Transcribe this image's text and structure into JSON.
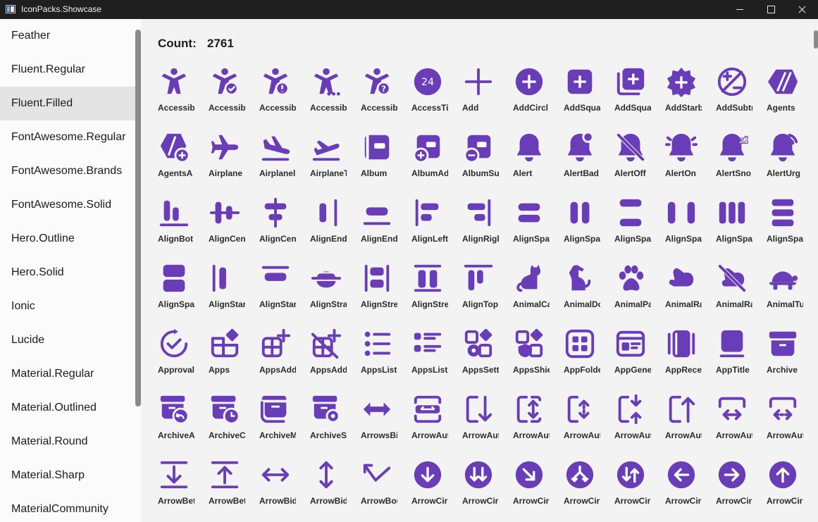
{
  "window": {
    "title": "IconPacks.Showcase"
  },
  "sidebar": {
    "items": [
      {
        "label": "Feather",
        "selected": false
      },
      {
        "label": "Fluent.Regular",
        "selected": false
      },
      {
        "label": "Fluent.Filled",
        "selected": true
      },
      {
        "label": "FontAwesome.Regular",
        "selected": false
      },
      {
        "label": "FontAwesome.Brands",
        "selected": false
      },
      {
        "label": "FontAwesome.Solid",
        "selected": false
      },
      {
        "label": "Hero.Outline",
        "selected": false
      },
      {
        "label": "Hero.Solid",
        "selected": false
      },
      {
        "label": "Ionic",
        "selected": false
      },
      {
        "label": "Lucide",
        "selected": false
      },
      {
        "label": "Material.Regular",
        "selected": false
      },
      {
        "label": "Material.Outlined",
        "selected": false
      },
      {
        "label": "Material.Round",
        "selected": false
      },
      {
        "label": "Material.Sharp",
        "selected": false
      },
      {
        "label": "MaterialCommunity",
        "selected": false
      }
    ]
  },
  "main": {
    "count_label": "Count:",
    "count_value": "2761",
    "icon_color": "#6a3db8",
    "icons": [
      {
        "label": "Accessib",
        "icon": "accessibility-icon"
      },
      {
        "label": "Accessib",
        "icon": "accessibility-check-icon"
      },
      {
        "label": "Accessib",
        "icon": "accessibility-error-icon"
      },
      {
        "label": "Accessib",
        "icon": "accessibility-more-icon"
      },
      {
        "label": "Accessib",
        "icon": "accessibility-question-icon"
      },
      {
        "label": "AccessTi",
        "icon": "access-time-24-icon",
        "glyph": "24"
      },
      {
        "label": "Add",
        "icon": "add-icon"
      },
      {
        "label": "AddCircl",
        "icon": "add-circle-icon"
      },
      {
        "label": "AddSqua",
        "icon": "add-square-icon"
      },
      {
        "label": "AddSqua",
        "icon": "add-square-multiple-icon"
      },
      {
        "label": "AddStarb",
        "icon": "add-starburst-icon"
      },
      {
        "label": "AddSubtr",
        "icon": "add-subtract-circle-icon"
      },
      {
        "label": "Agents",
        "icon": "agents-icon"
      },
      {
        "label": "AgentsA",
        "icon": "agents-add-icon"
      },
      {
        "label": "Airplane",
        "icon": "airplane-icon"
      },
      {
        "label": "Airplanel",
        "icon": "airplane-landing-icon"
      },
      {
        "label": "AirplaneT",
        "icon": "airplane-takeoff-icon"
      },
      {
        "label": "Album",
        "icon": "album-icon"
      },
      {
        "label": "AlbumAd",
        "icon": "album-add-icon"
      },
      {
        "label": "AlbumSu",
        "icon": "album-subtract-icon"
      },
      {
        "label": "Alert",
        "icon": "alert-icon"
      },
      {
        "label": "AlertBad",
        "icon": "alert-badge-icon"
      },
      {
        "label": "AlertOff",
        "icon": "alert-off-icon"
      },
      {
        "label": "AlertOn",
        "icon": "alert-on-icon"
      },
      {
        "label": "AlertSno",
        "icon": "alert-snooze-icon",
        "glyph": "zZ"
      },
      {
        "label": "AlertUrg",
        "icon": "alert-urgent-icon"
      },
      {
        "label": "AlignBot",
        "icon": "align-bottom-icon"
      },
      {
        "label": "AlignCen",
        "icon": "align-center-horizontal-icon"
      },
      {
        "label": "AlignCen",
        "icon": "align-center-vertical-icon"
      },
      {
        "label": "AlignEnd",
        "icon": "align-end-horizontal-icon"
      },
      {
        "label": "AlignEnd",
        "icon": "align-end-vertical-icon"
      },
      {
        "label": "AlignLeft",
        "icon": "align-left-icon"
      },
      {
        "label": "AlignRigl",
        "icon": "align-right-icon"
      },
      {
        "label": "AlignSpa",
        "icon": "align-space-around-horizontal-icon"
      },
      {
        "label": "AlignSpa",
        "icon": "align-space-around-vertical-icon"
      },
      {
        "label": "AlignSpa",
        "icon": "align-space-between-horizontal-icon"
      },
      {
        "label": "AlignSpa",
        "icon": "align-space-between-vertical-icon"
      },
      {
        "label": "AlignSpa",
        "icon": "align-space-evenly-horizontal-icon"
      },
      {
        "label": "AlignSpa",
        "icon": "align-space-evenly-vertical-icon"
      },
      {
        "label": "AlignSpa",
        "icon": "align-space-fit-vertical-icon"
      },
      {
        "label": "AlignStar",
        "icon": "align-start-horizontal-icon"
      },
      {
        "label": "AlignStar",
        "icon": "align-start-vertical-icon"
      },
      {
        "label": "AlignStra",
        "icon": "align-stretch-horizontal-icon"
      },
      {
        "label": "AlignStre",
        "icon": "align-stretch-vertical-icon"
      },
      {
        "label": "AlignStre",
        "icon": "align-stretch-top-icon"
      },
      {
        "label": "AlignTop",
        "icon": "align-top-icon"
      },
      {
        "label": "AnimalCa",
        "icon": "animal-cat-icon"
      },
      {
        "label": "AnimalDo",
        "icon": "animal-dog-icon"
      },
      {
        "label": "AnimalPa",
        "icon": "animal-paw-print-icon"
      },
      {
        "label": "AnimalRa",
        "icon": "animal-rabbit-icon"
      },
      {
        "label": "AnimalRa",
        "icon": "animal-rabbit-off-icon"
      },
      {
        "label": "AnimalTu",
        "icon": "animal-turtle-icon"
      },
      {
        "label": "Approval",
        "icon": "approvals-app-icon"
      },
      {
        "label": "Apps",
        "icon": "apps-icon"
      },
      {
        "label": "AppsAdd",
        "icon": "apps-add-in-icon"
      },
      {
        "label": "AppsAdd",
        "icon": "apps-add-in-off-icon"
      },
      {
        "label": "AppsList",
        "icon": "apps-list-icon"
      },
      {
        "label": "AppsList",
        "icon": "apps-list-detail-icon"
      },
      {
        "label": "AppsSett",
        "icon": "apps-settings-icon"
      },
      {
        "label": "AppsShie",
        "icon": "apps-shield-icon"
      },
      {
        "label": "AppFolde",
        "icon": "app-folder-icon"
      },
      {
        "label": "AppGene",
        "icon": "app-generic-icon"
      },
      {
        "label": "AppRece",
        "icon": "app-recent-icon"
      },
      {
        "label": "AppTitle",
        "icon": "app-title-icon"
      },
      {
        "label": "Archive",
        "icon": "archive-icon"
      },
      {
        "label": "ArchiveA",
        "icon": "archive-arrow-back-icon"
      },
      {
        "label": "ArchiveC",
        "icon": "archive-clock-icon"
      },
      {
        "label": "ArchiveM",
        "icon": "archive-multiple-icon"
      },
      {
        "label": "ArchiveS",
        "icon": "archive-settings-icon"
      },
      {
        "label": "ArrowsBi",
        "icon": "arrows-bidirectional-icon"
      },
      {
        "label": "ArrowAut",
        "icon": "arrow-autofit-content-icon"
      },
      {
        "label": "ArrowAut",
        "icon": "arrow-autofit-down-icon"
      },
      {
        "label": "ArrowAut",
        "icon": "arrow-autofit-height-icon"
      },
      {
        "label": "ArrowAut",
        "icon": "arrow-autofit-height-dotted-icon"
      },
      {
        "label": "ArrowAut",
        "icon": "arrow-autofit-height-in-icon"
      },
      {
        "label": "ArrowAut",
        "icon": "arrow-autofit-up-icon"
      },
      {
        "label": "ArrowAut",
        "icon": "arrow-autofit-width-icon"
      },
      {
        "label": "ArrowAut",
        "icon": "arrow-autofit-width-dotted-icon"
      },
      {
        "label": "ArrowBet",
        "icon": "arrow-between-down-icon"
      },
      {
        "label": "ArrowBet",
        "icon": "arrow-between-up-icon"
      },
      {
        "label": "ArrowBid",
        "icon": "arrow-bidirectional-left-right-icon"
      },
      {
        "label": "ArrowBid",
        "icon": "arrow-bidirectional-up-down-icon"
      },
      {
        "label": "ArrowBou",
        "icon": "arrow-bounce-icon"
      },
      {
        "label": "ArrowCir",
        "icon": "arrow-circle-down-icon"
      },
      {
        "label": "ArrowCir",
        "icon": "arrow-circle-down-double-icon"
      },
      {
        "label": "ArrowCir",
        "icon": "arrow-circle-down-right-icon"
      },
      {
        "label": "ArrowCir",
        "icon": "arrow-circle-down-split-icon"
      },
      {
        "label": "ArrowCir",
        "icon": "arrow-circle-down-up-icon"
      },
      {
        "label": "ArrowCir",
        "icon": "arrow-circle-left-icon"
      },
      {
        "label": "ArrowCir",
        "icon": "arrow-circle-right-icon"
      },
      {
        "label": "ArrowCir",
        "icon": "arrow-circle-up-icon"
      }
    ]
  }
}
